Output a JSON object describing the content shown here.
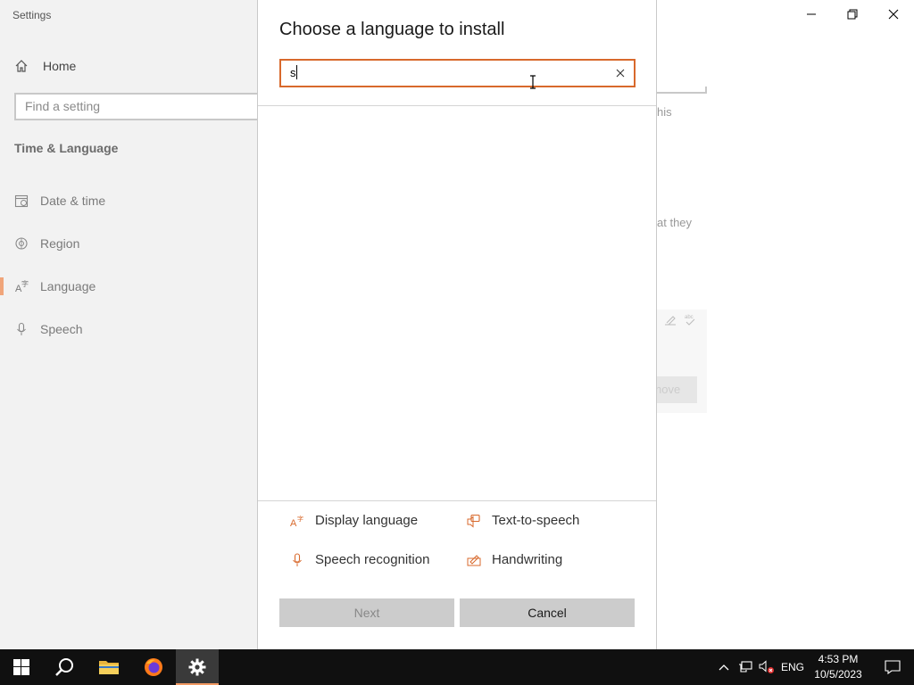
{
  "settings": {
    "app_title": "Settings",
    "home_label": "Home",
    "find_placeholder": "Find a setting",
    "section_title": "Time & Language",
    "nav": [
      {
        "label": "Date & time",
        "icon": "calendar-icon"
      },
      {
        "label": "Region",
        "icon": "globe-icon"
      },
      {
        "label": "Language",
        "icon": "language-icon",
        "selected": true
      },
      {
        "label": "Speech",
        "icon": "microphone-icon"
      }
    ],
    "bg_fragments": {
      "frag1": "his",
      "frag2": "at they",
      "remove_fragment": "nove"
    }
  },
  "dialog": {
    "title": "Choose a language to install",
    "search_value": "s",
    "features": {
      "display_language": "Display language",
      "text_to_speech": "Text-to-speech",
      "speech_recognition": "Speech recognition",
      "handwriting": "Handwriting"
    },
    "next_label": "Next",
    "cancel_label": "Cancel"
  },
  "taskbar": {
    "language": "ENG",
    "time": "4:53 PM",
    "date": "10/5/2023"
  },
  "colors": {
    "accent": "#d8692c",
    "sidebar_bg": "#f2f2f2",
    "taskbar_bg": "#101010"
  }
}
